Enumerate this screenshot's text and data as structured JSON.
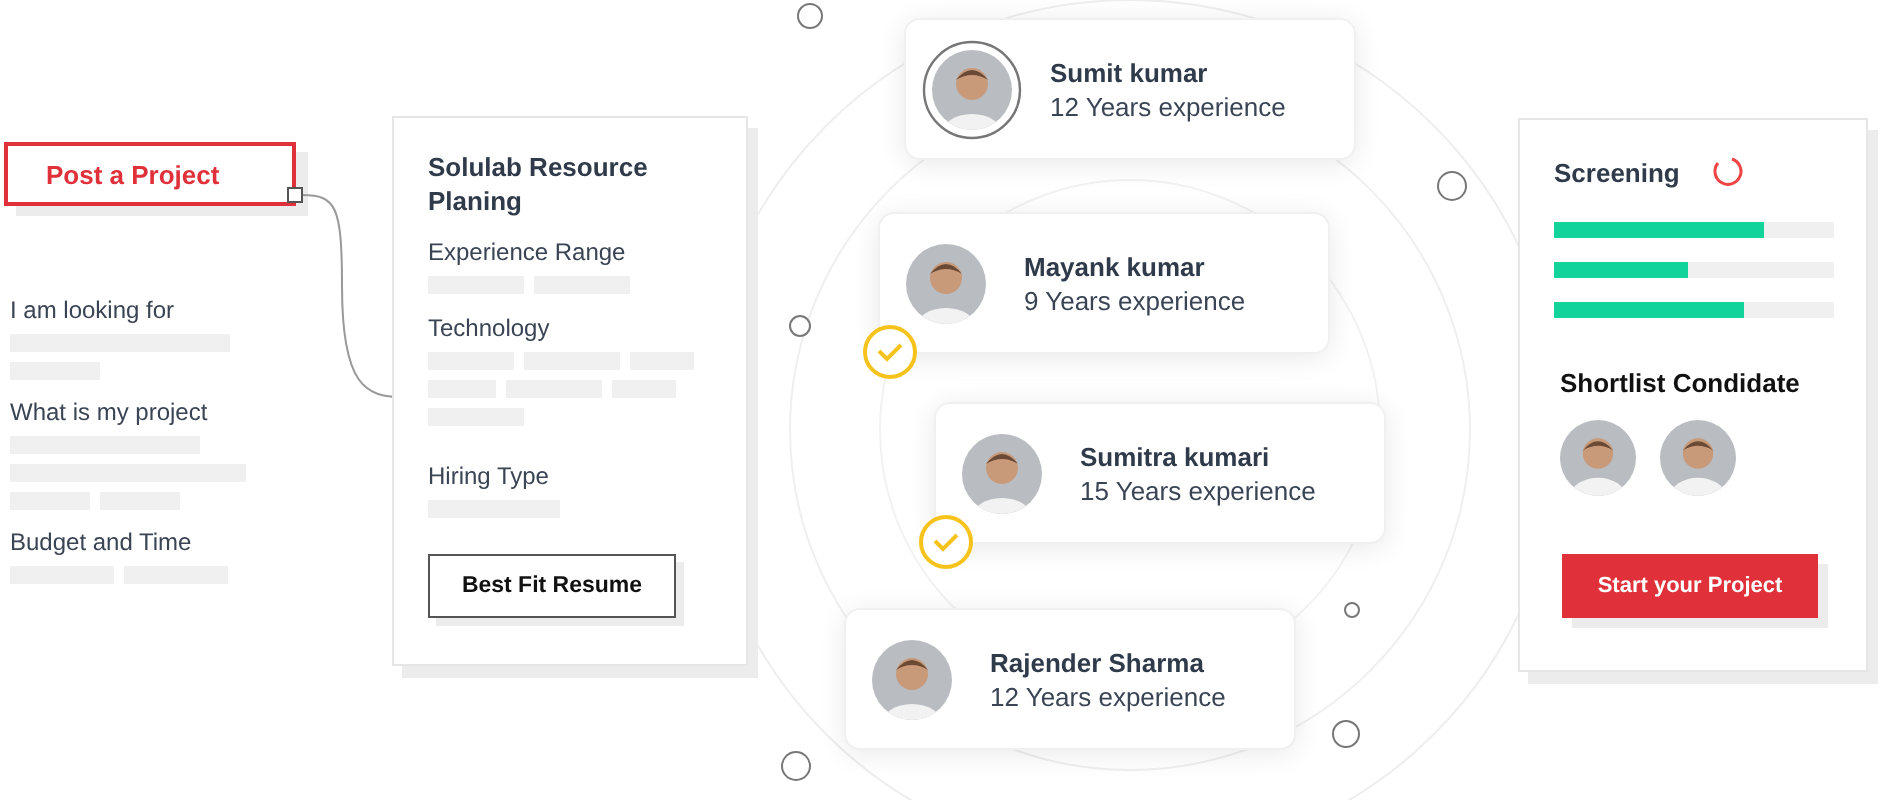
{
  "post_button": {
    "label": "Post a Project"
  },
  "project_form": {
    "fields": [
      {
        "label": "I am looking for"
      },
      {
        "label": "What is my project"
      },
      {
        "label": "Budget and Time"
      }
    ]
  },
  "resource_card": {
    "title": "Solulab Resource Planing",
    "fields": [
      {
        "label": "Experience Range"
      },
      {
        "label": "Technology"
      },
      {
        "label": "Hiring Type"
      }
    ],
    "button": "Best Fit Resume"
  },
  "candidates": [
    {
      "name": "Sumit kumar",
      "experience": "12 Years experience",
      "selected": true,
      "checked": false
    },
    {
      "name": "Mayank kumar",
      "experience": "9 Years experience",
      "selected": false,
      "checked": true
    },
    {
      "name": "Sumitra kumari",
      "experience": "15 Years experience",
      "selected": false,
      "checked": true
    },
    {
      "name": "Rajender Sharma",
      "experience": "12 Years experience",
      "selected": false,
      "checked": false
    }
  ],
  "screening": {
    "title": "Screening",
    "bars": [
      {
        "level": 0.75
      },
      {
        "level": 0.48
      },
      {
        "level": 0.68
      }
    ],
    "shortlist_title": "Shortlist Condidate",
    "button": "Start your Project"
  }
}
